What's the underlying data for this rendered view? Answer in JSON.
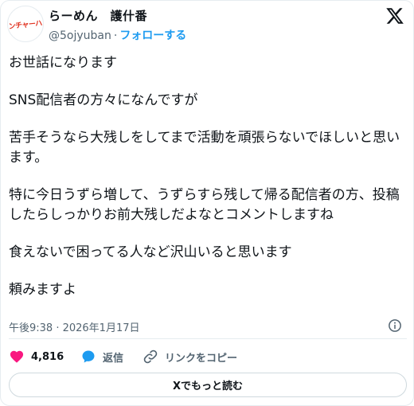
{
  "user": {
    "avatar_text": "ワンチャーハン",
    "display_name": "らーめん　護什番",
    "handle": "@5ojyuban",
    "separator": "·",
    "follow_label": "フォローする"
  },
  "tweet": {
    "paragraphs": [
      "お世話になります",
      "SNS配信者の方々になんですが",
      "苦手そうなら大残しをしてまで活動を頑張らないでほしいと思います。",
      "特に今日うずら増して、うずらすら残して帰る配信者の方、投稿したらしっかりお前大残しだよなとコメントしますね",
      "食えないで困ってる人など沢山いると思います",
      "頼みますよ"
    ],
    "timestamp": "午後9:38 · 2026年1月17日"
  },
  "actions": {
    "likes_count": "4,816",
    "reply_label": "返信",
    "copy_link_label": "リンクをコピー"
  },
  "read_more_label": "Xでもっと読む",
  "colors": {
    "like": "#f91880",
    "link": "#1d9bf0",
    "muted": "#536471",
    "text": "#0f1419"
  },
  "icons": {
    "brand": "x-logo-icon",
    "info": "info-icon",
    "like": "heart-icon",
    "reply": "reply-bubble-icon",
    "copy_link": "link-icon"
  }
}
